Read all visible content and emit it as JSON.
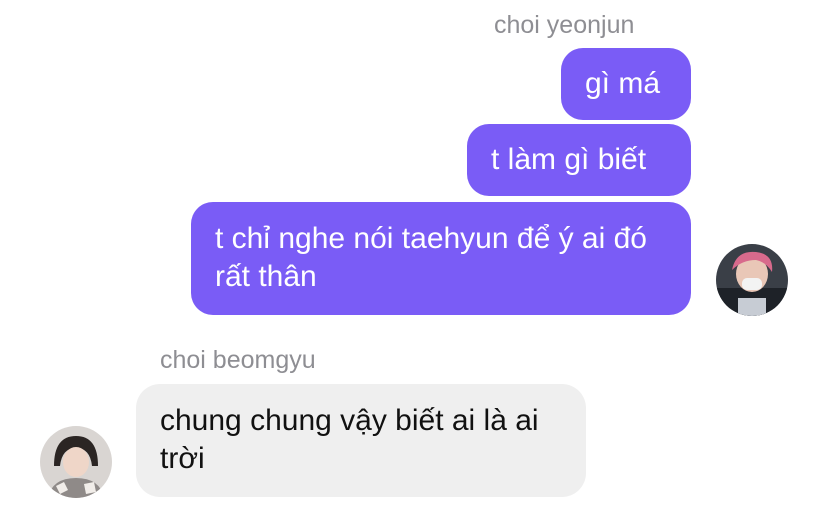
{
  "thread": {
    "outgoing": {
      "sender_name": "choi yeonjun",
      "avatar_icon": "profile-photo-icon",
      "messages": [
        "gì má",
        "t làm gì biết",
        "t chỉ nghe nói taehyun để ý ai đó rất thân"
      ]
    },
    "incoming": {
      "sender_name": "choi beomgyu",
      "avatar_icon": "profile-photo-icon",
      "messages": [
        "chung chung vậy biết ai là ai trời"
      ]
    }
  },
  "colors": {
    "outgoing_bubble": "#7a5cf6",
    "incoming_bubble": "#efefef",
    "sender_name": "#8e8e93"
  }
}
